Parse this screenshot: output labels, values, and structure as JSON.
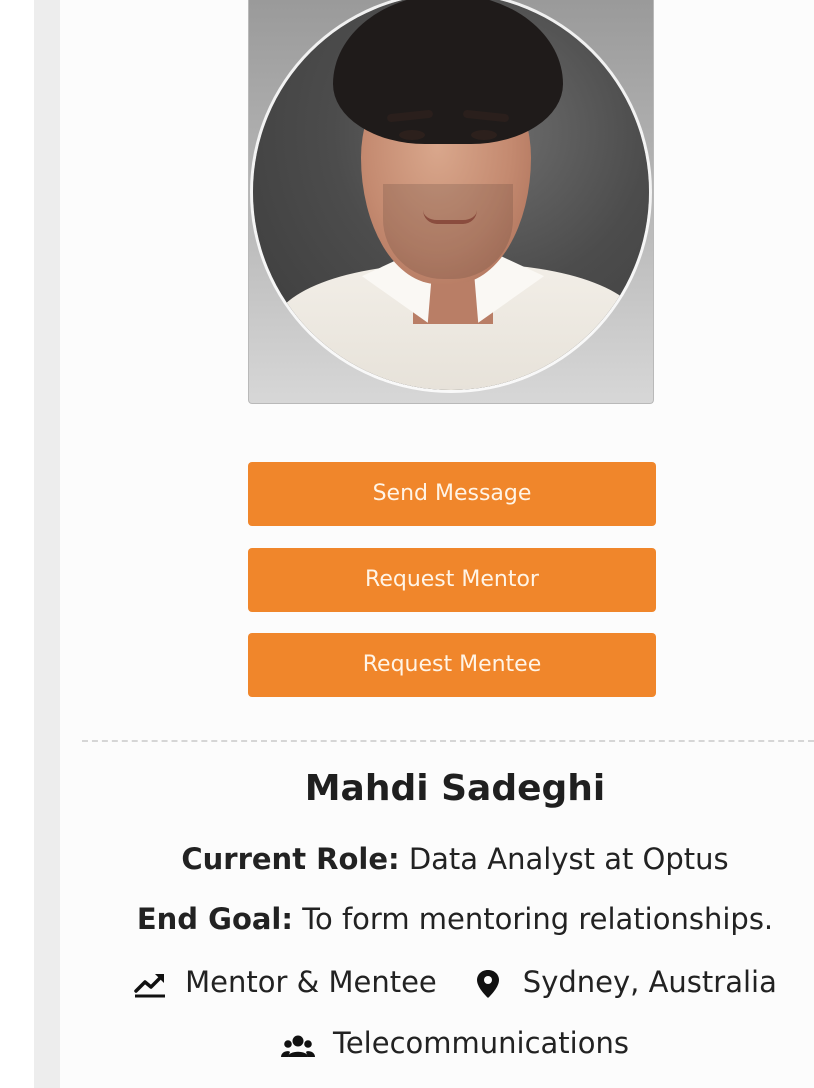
{
  "profile": {
    "name": "Mahdi Sadeghi",
    "photo_icon": "profile-photo"
  },
  "actions": {
    "send_message": "Send Message",
    "request_mentor": "Request Mentor",
    "request_mentee": "Request Mentee"
  },
  "details": {
    "role_label": "Current Role:",
    "role_value": "Data Analyst at Optus",
    "goal_label": "End Goal:",
    "goal_value": "To form mentoring relationships.",
    "type": "Mentor & Mentee",
    "type_icon": "trending-up-icon",
    "location": "Sydney, Australia",
    "location_icon": "map-pin-icon",
    "industry": "Telecommunications",
    "industry_icon": "group-icon"
  },
  "colors": {
    "accent": "#f0862b",
    "button_text": "#fff4e6",
    "text": "#222222"
  }
}
